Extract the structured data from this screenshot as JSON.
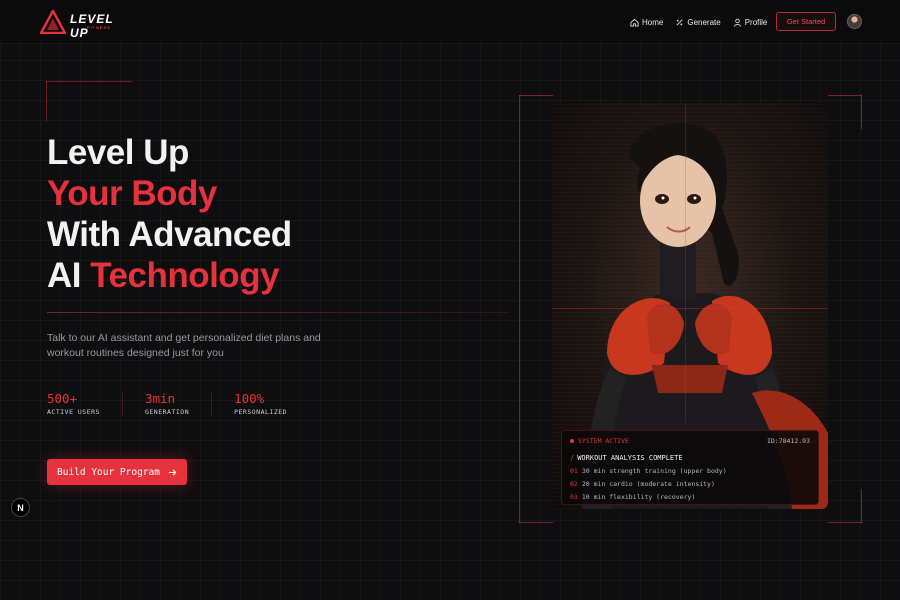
{
  "nav": {
    "logo_text": "LEVEL UP",
    "logo_sub": "FITNESS",
    "links": [
      {
        "label": "Home",
        "icon": "home-icon"
      },
      {
        "label": "Generate",
        "icon": "generate-icon"
      },
      {
        "label": "Profile",
        "icon": "user-icon"
      }
    ],
    "cta_label": "Get Started"
  },
  "hero": {
    "line1": "Level Up",
    "line2": "Your Body",
    "line3": "With Advanced",
    "line4_a": "AI ",
    "line4_b": "Technology",
    "description": "Talk to our AI assistant and get personalized diet plans and workout routines designed just for you",
    "stats": [
      {
        "value": "500+",
        "label": "ACTIVE USERS"
      },
      {
        "value": "3min",
        "label": "GENERATION"
      },
      {
        "value": "100%",
        "label": "PERSONALIZED"
      }
    ],
    "cta_label": "Build Your Program"
  },
  "badge": {
    "letter": "N"
  },
  "terminal": {
    "status": "SYSTEM ACTIVE",
    "id": "ID:78412.93",
    "heading_slash": "/",
    "heading": "WORKOUT ANALYSIS COMPLETE",
    "items": [
      {
        "num": "01",
        "text": "30 min strength training (upper body)"
      },
      {
        "num": "02",
        "text": "20 min cardio (moderate intensity)"
      },
      {
        "num": "03",
        "text": "10 min flexibility (recovery)"
      }
    ]
  },
  "colors": {
    "accent": "#e5323c",
    "background": "#0e0e10",
    "muted_text": "#9a9a9e"
  }
}
